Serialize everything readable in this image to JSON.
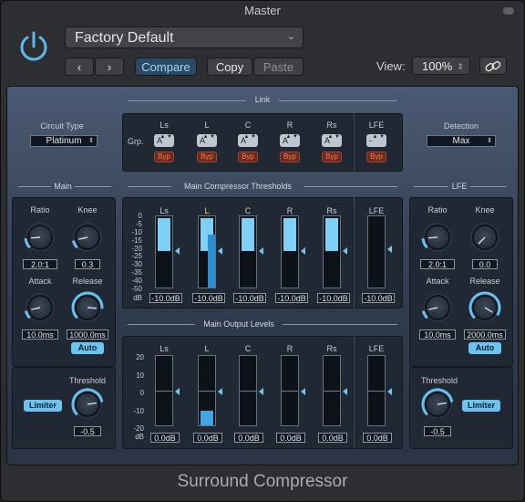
{
  "window": {
    "title": "Master",
    "footer": "Surround Compressor"
  },
  "toolbar": {
    "preset": "Factory Default",
    "compare": "Compare",
    "copy": "Copy",
    "paste": "Paste",
    "view_label": "View:",
    "view_value": "100%"
  },
  "link": {
    "title": "Link",
    "grp": "Grp.",
    "channels": [
      {
        "name": "Ls",
        "grp": "A",
        "byp": "Byp"
      },
      {
        "name": "L",
        "grp": "A",
        "byp": "Byp"
      },
      {
        "name": "C",
        "grp": "A",
        "byp": "Byp"
      },
      {
        "name": "R",
        "grp": "A",
        "byp": "Byp"
      },
      {
        "name": "Rs",
        "grp": "A",
        "byp": "Byp"
      },
      {
        "name": "LFE",
        "grp": "-",
        "byp": "Byp"
      }
    ]
  },
  "circuit": {
    "label": "Circuit Type",
    "value": "Platinum"
  },
  "detection": {
    "label": "Detection",
    "value": "Max"
  },
  "main": {
    "title": "Main",
    "ratio_label": "Ratio",
    "ratio": "2.0:1",
    "knee_label": "Knee",
    "knee": "0.3",
    "attack_label": "Attack",
    "attack": "10.0ms",
    "release_label": "Release",
    "release": "1000.0ms",
    "auto": "Auto",
    "limiter": "Limiter",
    "threshold_label": "Threshold",
    "threshold": "-0.5"
  },
  "lfe": {
    "title": "LFE",
    "ratio_label": "Ratio",
    "ratio": "2.0:1",
    "knee_label": "Knee",
    "knee": "0.0",
    "attack_label": "Attack",
    "attack": "10.0ms",
    "release_label": "Release",
    "release": "2000.0ms",
    "auto": "Auto",
    "limiter": "Limiter",
    "threshold_label": "Threshold",
    "threshold": "-0.5"
  },
  "thresholds": {
    "title": "Main Compressor Thresholds",
    "scale": [
      "0",
      "-5",
      "-10",
      "-15",
      "-20",
      "-25",
      "-30",
      "-35",
      "-40",
      "-50"
    ],
    "db": "dB",
    "channels": [
      {
        "name": "Ls",
        "value": "-10.0dB",
        "level": 0.33
      },
      {
        "name": "L",
        "value": "-10.0dB",
        "level": 0.33
      },
      {
        "name": "C",
        "value": "-10.0dB",
        "level": 0.33
      },
      {
        "name": "R",
        "value": "-10.0dB",
        "level": 0.33
      },
      {
        "name": "Rs",
        "value": "-10.0dB",
        "level": 0.33
      },
      {
        "name": "LFE",
        "value": "-10.0dB",
        "level": 0
      }
    ]
  },
  "outputs": {
    "title": "Main Output Levels",
    "scale": [
      "20",
      "10",
      "0",
      "-10",
      "-20"
    ],
    "db": "dB",
    "channels": [
      {
        "name": "Ls",
        "value": "0.0dB"
      },
      {
        "name": "L",
        "value": "0.0dB"
      },
      {
        "name": "C",
        "value": "0.0dB"
      },
      {
        "name": "R",
        "value": "0.0dB"
      },
      {
        "name": "Rs",
        "value": "0.0dB"
      },
      {
        "name": "LFE",
        "value": "0.0dB"
      }
    ]
  },
  "icons": {
    "power": "power-icon",
    "link": "link-icon",
    "chev": "chevron-down-icon"
  }
}
